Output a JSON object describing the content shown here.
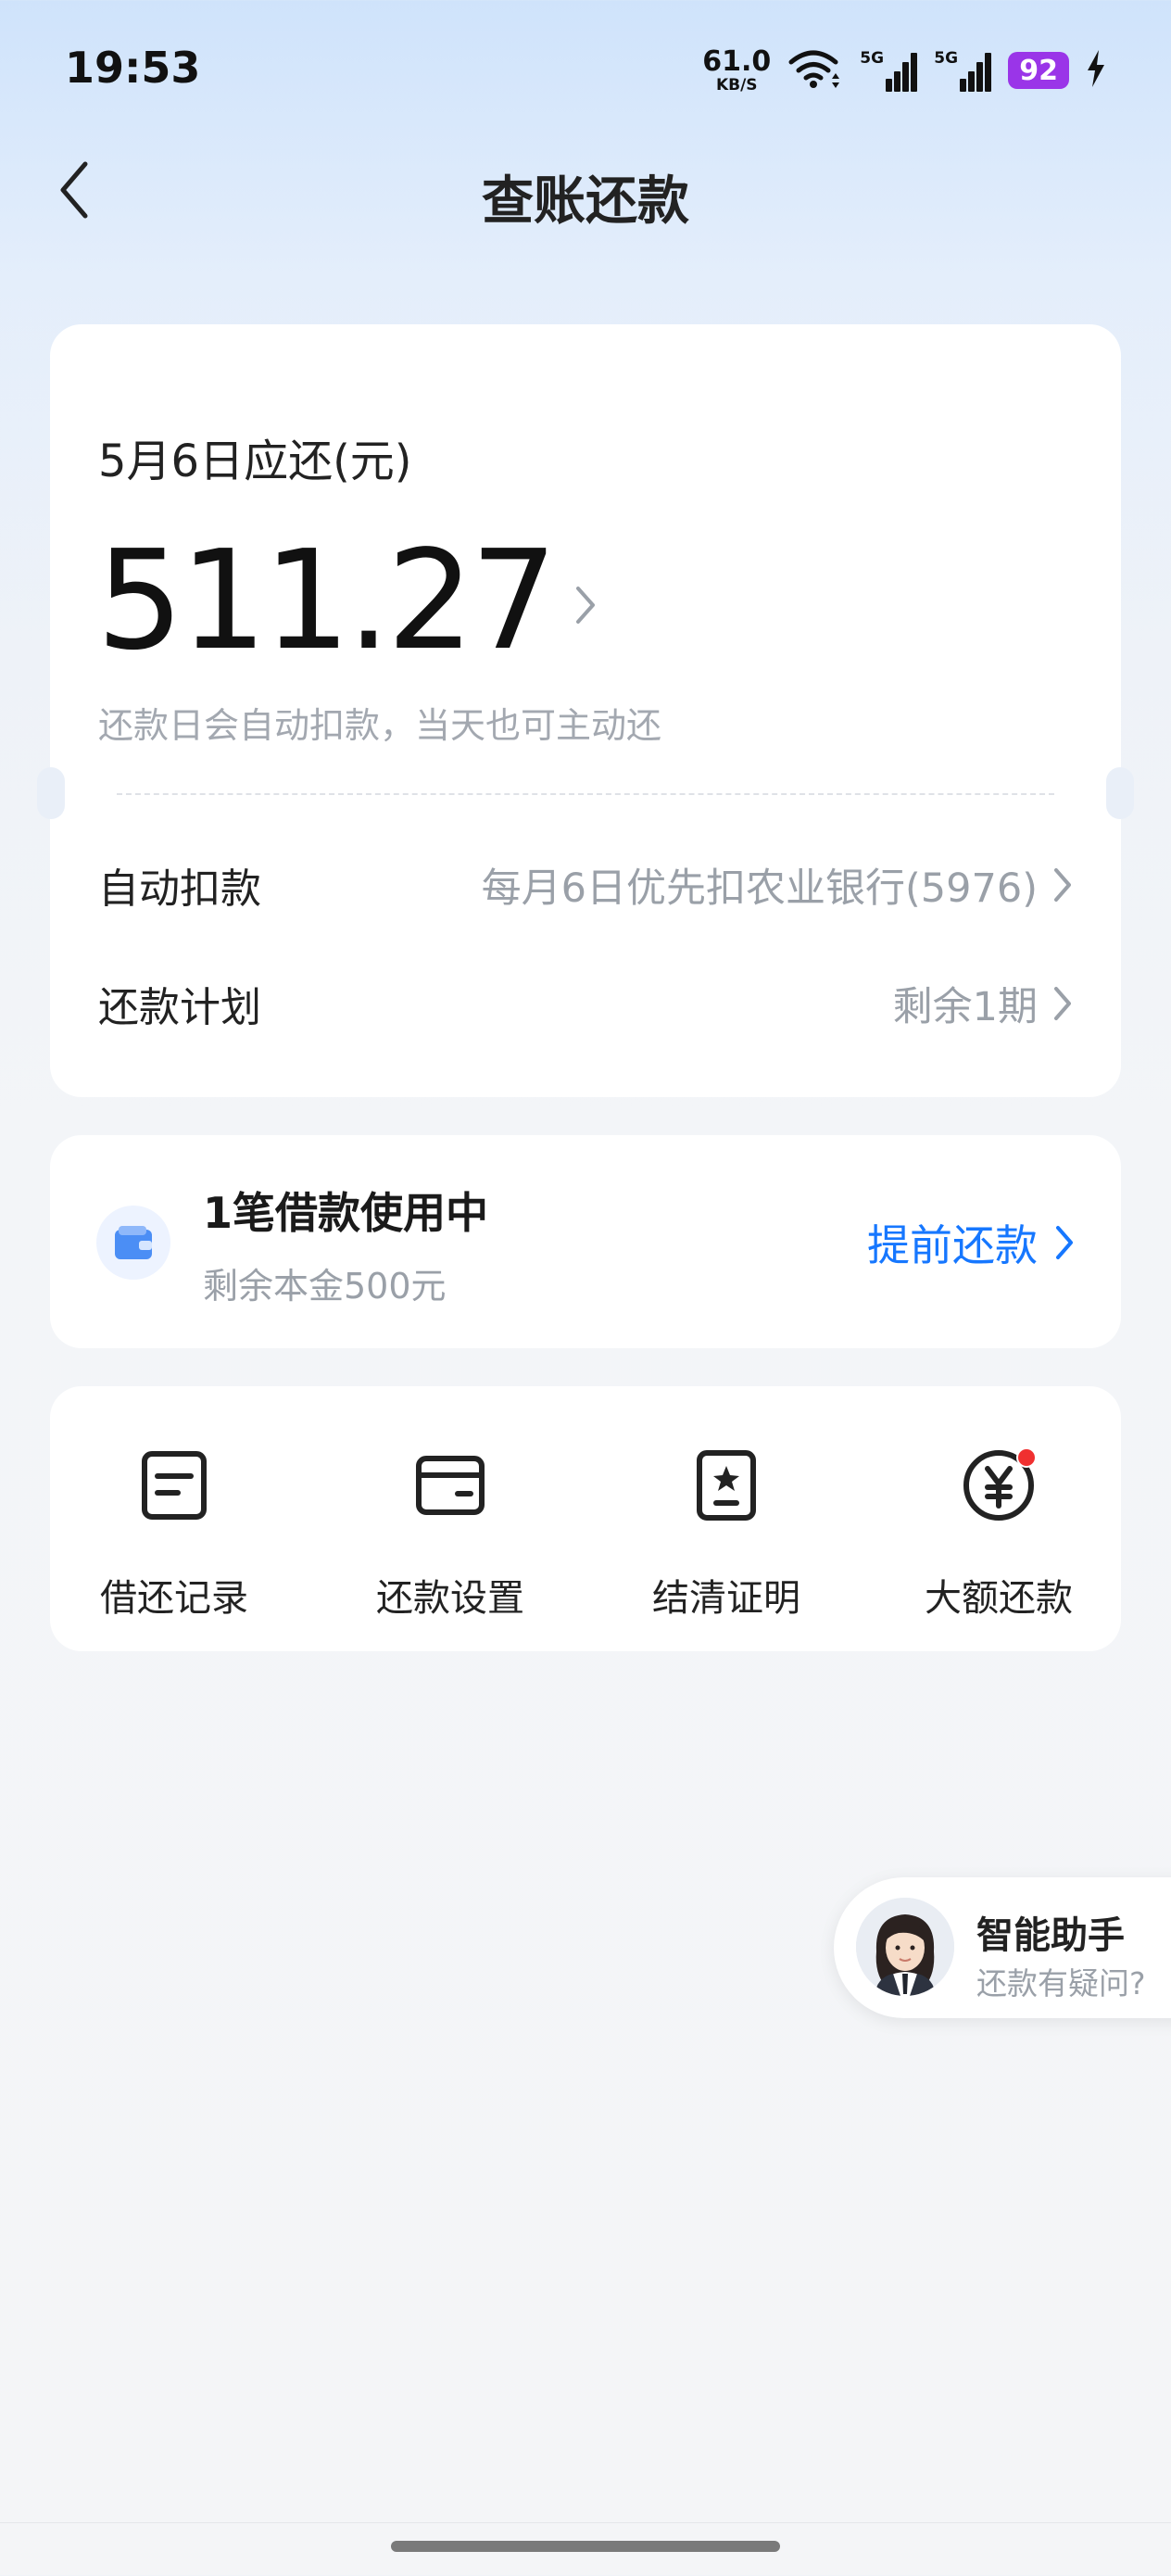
{
  "status_bar": {
    "time": "19:53",
    "net_speed_value": "61.0",
    "net_speed_unit": "KB/S",
    "signal1_tag": "5G",
    "signal2_tag": "5G",
    "battery": "92",
    "icons": [
      "wifi-icon",
      "signal-icon",
      "signal-icon",
      "battery-icon",
      "charging-icon"
    ]
  },
  "header": {
    "title": "查账还款",
    "back_icon": "chevron-left-icon"
  },
  "bill": {
    "due_label": "5月6日应还(元)",
    "amount": "511.27",
    "hint": "还款日会自动扣款，当天也可主动还",
    "rows": [
      {
        "label": "自动扣款",
        "value": "每月6日优先扣农业银行(5976)"
      },
      {
        "label": "还款计划",
        "value": "剩余1期"
      }
    ]
  },
  "loan": {
    "title": "1笔借款使用中",
    "subtitle": "剩余本金500元",
    "prepay": "提前还款",
    "accent": "#1677ff"
  },
  "actions": [
    {
      "label": "借还记录",
      "icon": "record-icon"
    },
    {
      "label": "还款设置",
      "icon": "card-icon"
    },
    {
      "label": "结清证明",
      "icon": "certificate-icon"
    },
    {
      "label": "大额还款",
      "icon": "yuan-icon"
    }
  ],
  "assistant": {
    "title": "智能助手",
    "subtitle": "还款有疑问?"
  }
}
